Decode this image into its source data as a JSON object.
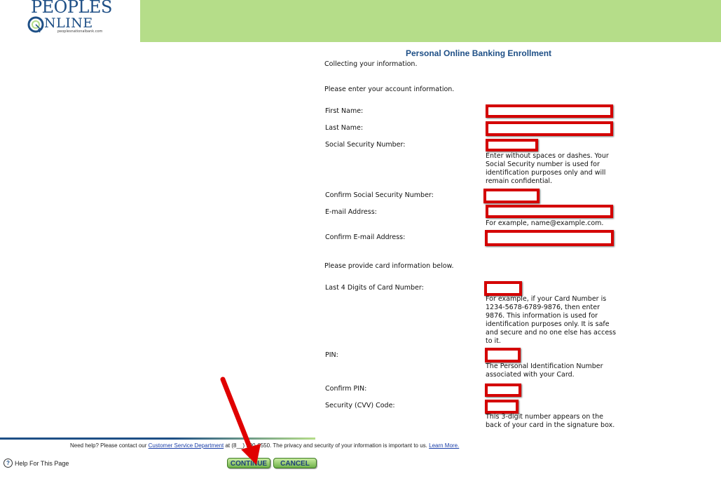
{
  "logo": {
    "line1": "PEOPLES",
    "line2": "NLINE",
    "url": "peoplesnationalbank.com"
  },
  "page_title": "Personal Online Banking Enrollment",
  "intro": "Collecting your information.",
  "account_prompt": "Please enter your account information.",
  "fields": {
    "first_name": {
      "label": "First Name:"
    },
    "last_name": {
      "label": "Last Name:"
    },
    "ssn": {
      "label": "Social Security Number:",
      "help": [
        "Enter without spaces or dashes. Your",
        "Social Security number is used for",
        "identification purposes only and will",
        "remain confidential."
      ]
    },
    "confirm_ssn": {
      "label": "Confirm Social Security Number:"
    },
    "email": {
      "label": "E-mail Address:",
      "help": [
        "For example, name@example.com."
      ]
    },
    "confirm_email": {
      "label": "Confirm E-mail Address:"
    },
    "card_last4": {
      "label": "Last 4 Digits of Card Number:",
      "help": [
        "For example, if your Card Number is",
        "1234-5678-6789-9876, then enter",
        "9876. This information is used for",
        "identification purposes only. It is safe",
        "and secure and no one else has access",
        "to it."
      ]
    },
    "pin": {
      "label": "PIN:",
      "help": [
        "The Personal Identification Number",
        "associated with your Card."
      ]
    },
    "confirm_pin": {
      "label": "Confirm PIN:"
    },
    "cvv": {
      "label": "Security (CVV) Code:",
      "help": [
        "This 3-digit number appears on the",
        "back of your card in the signature box."
      ]
    }
  },
  "card_prompt": "Please provide card information below.",
  "footer": {
    "text_before": "Need help? Please contact our ",
    "link": "Customer Service Department",
    "text_after": " at (8__) 900-6550. The privacy and security of your information is important to us. ",
    "learn_more": "Learn More."
  },
  "help_page": "Help For This Page",
  "buttons": {
    "continue": "CONTINUE",
    "cancel": "CANCEL"
  },
  "colors": {
    "brand_blue": "#1e4f86",
    "brand_green": "#b5dd89",
    "highlight_red": "#d40000"
  }
}
